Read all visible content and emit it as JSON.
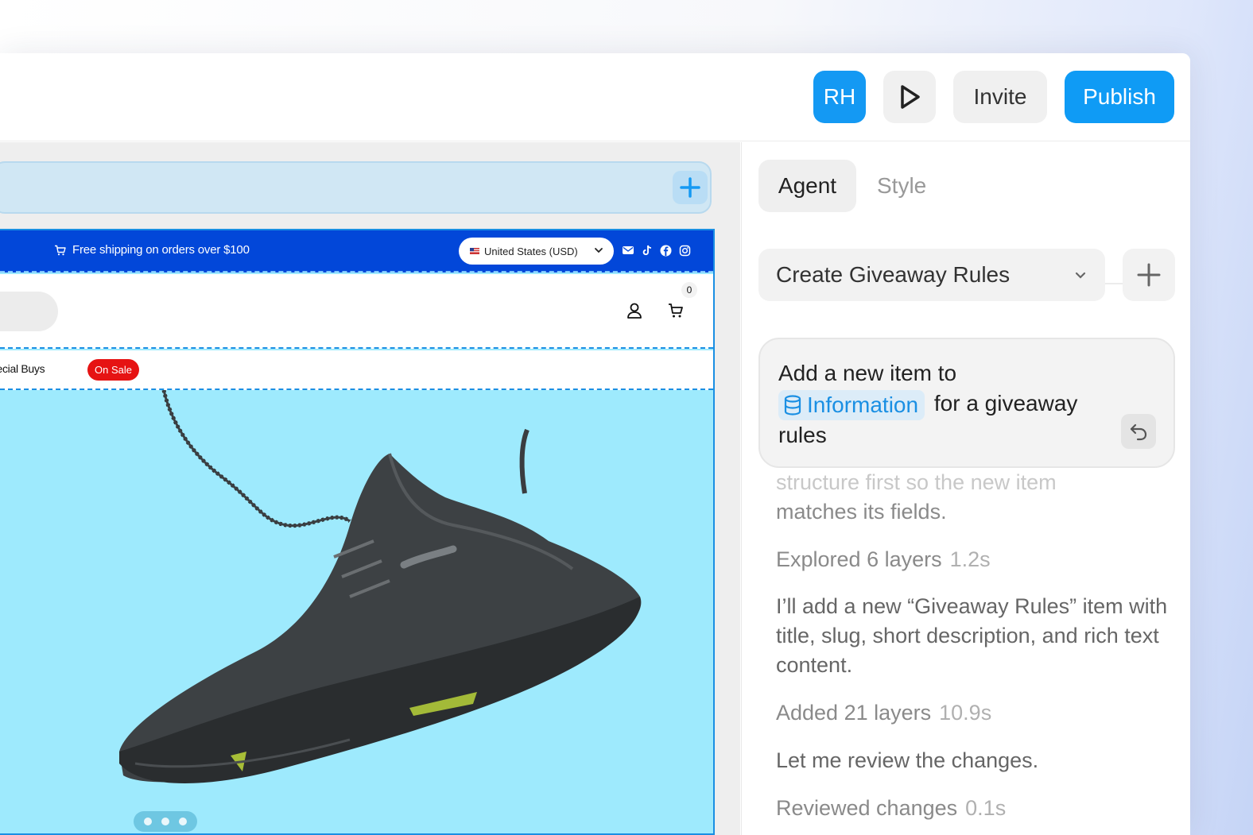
{
  "topbar": {
    "avatar_initials": "RH",
    "invite_label": "Invite",
    "publish_label": "Publish",
    "play_icon": "play-icon"
  },
  "colors": {
    "accent": "#0f9bf5",
    "announcement_bg": "#0247d9",
    "hero_bg": "#9eeafd",
    "sale_badge": "#e61313"
  },
  "site": {
    "announcement": "Free shipping on orders over $100",
    "country_selector": "United States (USD)",
    "cart_count": "0",
    "nav_item": "pecial Buys",
    "sale_badge": "On Sale",
    "social_icons": [
      "mail-icon",
      "tiktok-icon",
      "facebook-icon",
      "instagram-icon"
    ]
  },
  "panel": {
    "tabs": [
      "Agent",
      "Style"
    ],
    "selected_task": "Create Giveaway Rules",
    "message": {
      "prefix": "Add a new item to",
      "chip": "Information",
      "suffix": "for a giveaway",
      "line3": "rules"
    },
    "feed": {
      "faded_line": "structure first so the new item",
      "line2": "matches its fields.",
      "step1_label": "Explored 6 layers",
      "step1_time": "1.2s",
      "para1": "I’ll add a new “Giveaway Rules” item with title, slug, short description, and rich text content.",
      "step2_label": "Added 21 layers",
      "step2_time": "10.9s",
      "para2": "Let me review the changes.",
      "step3_label": "Reviewed changes",
      "step3_time": "0.1s"
    }
  }
}
